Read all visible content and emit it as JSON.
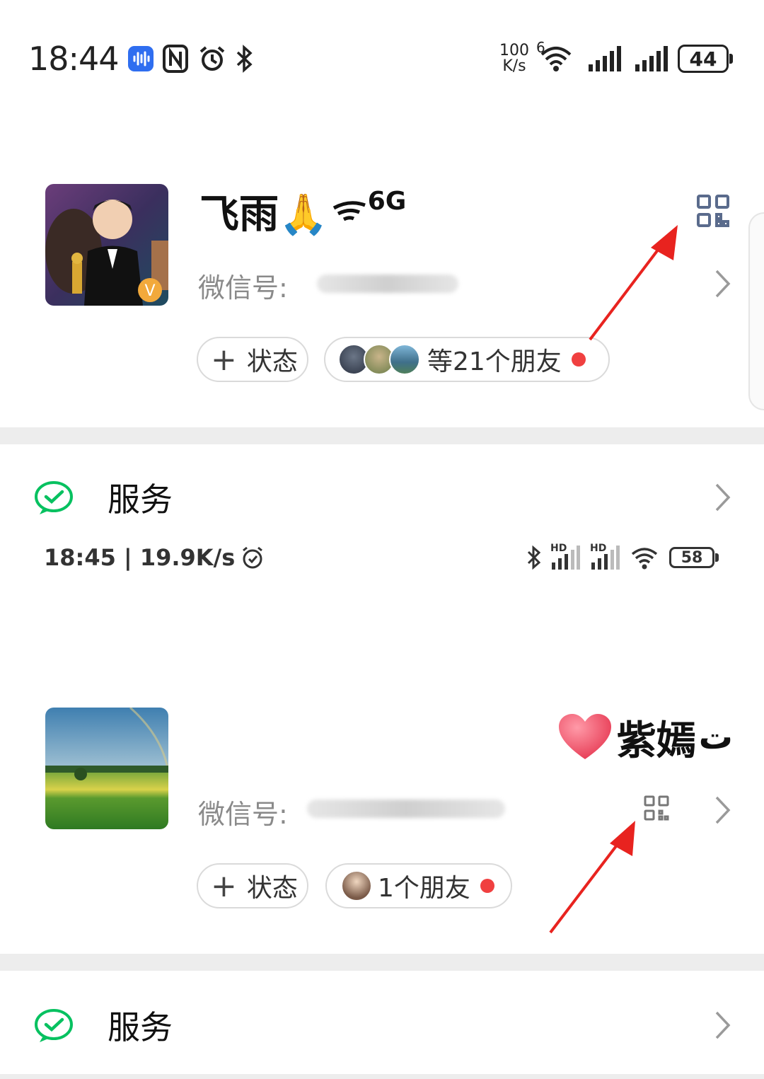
{
  "screen1": {
    "status_bar": {
      "time": "18:44",
      "speed_value": "100",
      "speed_unit": "K/s",
      "wifi_gen": "6",
      "battery": "44"
    },
    "profile": {
      "name": "飞雨🙏",
      "name_suffix": "6G",
      "wechat_id_label": "微信号:",
      "status_chip_label": "状态",
      "friends_chip_label": "等21个朋友"
    },
    "service": {
      "label": "服务"
    }
  },
  "screen2": {
    "status_bar": {
      "time_speed": "18:45 | 19.9K/s",
      "signal_label_1": "HD",
      "signal_label_2": "HD",
      "battery": "58"
    },
    "profile": {
      "name": "紫嫣",
      "name_suffix": "ت",
      "wechat_id_label": "微信号:",
      "status_chip_label": "状态",
      "friends_chip_label": "1个朋友"
    },
    "service": {
      "label": "服务"
    }
  },
  "colors": {
    "wechat_green": "#07c160",
    "red_dot": "#f04040",
    "arrow_red": "#e8231f",
    "qr_icon": "#5a6b8c"
  }
}
